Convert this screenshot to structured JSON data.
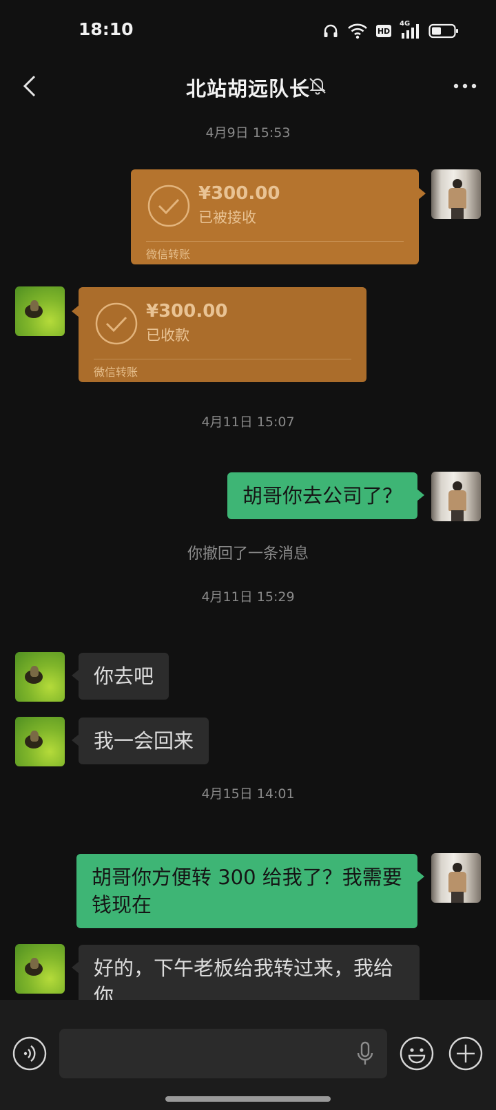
{
  "status_bar": {
    "time": "18:10",
    "icons": [
      "headphones-icon",
      "wifi-icon",
      "hd-icon",
      "signal-4g-icon",
      "battery-icon"
    ],
    "hd_label": "HD",
    "network_label": "4G"
  },
  "nav": {
    "title": "北站胡远队长",
    "icons": [
      "back-arrow-icon",
      "mute-bell-icon",
      "more-dots-icon"
    ]
  },
  "colors": {
    "background": "#111111",
    "sent_bubble": "#3eb575",
    "received_bubble": "#2c2c2c",
    "transfer_card": "#b5742e",
    "timestamp_text": "#8a8a8a"
  },
  "messages": [
    {
      "kind": "timestamp",
      "text": "4月9日 15:53"
    },
    {
      "kind": "transfer",
      "sender": "me",
      "amount": "¥300.00",
      "status": "已被接收",
      "footer": "微信转账"
    },
    {
      "kind": "transfer",
      "sender": "other",
      "amount": "¥300.00",
      "status": "已收款",
      "footer": "微信转账"
    },
    {
      "kind": "timestamp",
      "text": "4月11日 15:07"
    },
    {
      "kind": "text",
      "sender": "me",
      "text": "胡哥你去公司了？"
    },
    {
      "kind": "system",
      "text": "你撤回了一条消息"
    },
    {
      "kind": "timestamp",
      "text": "4月11日 15:29"
    },
    {
      "kind": "text",
      "sender": "other",
      "text": "你去吧"
    },
    {
      "kind": "text",
      "sender": "other",
      "text": "我一会回来"
    },
    {
      "kind": "timestamp",
      "text": "4月15日 14:01"
    },
    {
      "kind": "text",
      "sender": "me",
      "text": "胡哥你方便转 300 给我了？我需要钱现在"
    },
    {
      "kind": "text",
      "sender": "other",
      "text": "好的，下午老板给我转过来，我给你"
    }
  ],
  "input_bar": {
    "icons": [
      "voice-toggle-icon",
      "microphone-icon",
      "emoji-icon",
      "plus-icon"
    ],
    "text_value": ""
  }
}
